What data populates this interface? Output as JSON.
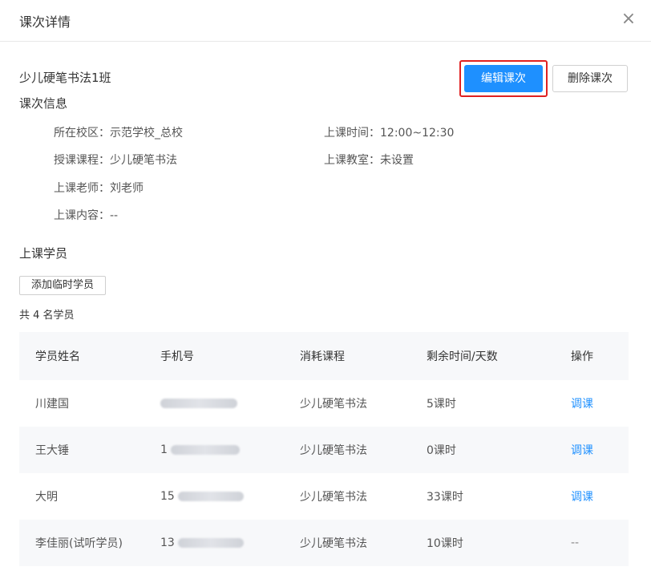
{
  "dialog": {
    "title": "课次详情",
    "close_icon": "×"
  },
  "lesson": {
    "name": "少儿硬笔书法1班",
    "edit_button": "编辑课次",
    "delete_button": "删除课次"
  },
  "info": {
    "section_title": "课次信息",
    "campus_label": "所在校区：",
    "campus_value": "示范学校_总校",
    "time_label": "上课时间：",
    "time_value": "12:00~12:30",
    "course_label": "授课课程：",
    "course_value": "少儿硬笔书法",
    "room_label": "上课教室：",
    "room_value": "未设置",
    "teacher_label": "上课老师：",
    "teacher_value": "刘老师",
    "content_label": "上课内容：",
    "content_value": "--"
  },
  "students": {
    "section_title": "上课学员",
    "add_temp_button": "添加临时学员",
    "count_text": "共 4 名学员",
    "columns": [
      "学员姓名",
      "手机号",
      "消耗课程",
      "剩余时间/天数",
      "操作"
    ],
    "rows": [
      {
        "name": "川建国",
        "phone_prefix": "",
        "course": "少儿硬笔书法",
        "remaining": "5课时",
        "action": "调课"
      },
      {
        "name": "王大锤",
        "phone_prefix": "1",
        "course": "少儿硬笔书法",
        "remaining": "0课时",
        "action": "调课"
      },
      {
        "name": "大明",
        "phone_prefix": "15",
        "course": "少儿硬笔书法",
        "remaining": "33课时",
        "action": "调课"
      },
      {
        "name": "李佳丽(试听学员)",
        "phone_prefix": "13",
        "course": "少儿硬笔书法",
        "remaining": "10课时",
        "action": "--"
      }
    ]
  },
  "colors": {
    "primary": "#1e90ff",
    "highlight_border": "#e02020",
    "table_header_bg": "#f7f8fa"
  }
}
